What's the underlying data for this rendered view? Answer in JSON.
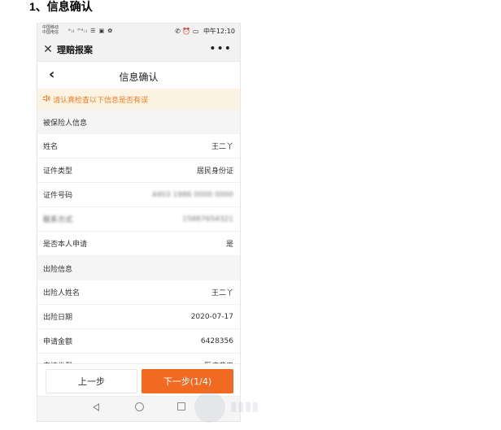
{
  "doc_heading": "1、信息确认",
  "status_bar": {
    "carrier_1": "中国移动",
    "carrier_2": "中国电信",
    "signal_icons": "ᵃᵢₗ ᴴᵃᵢₗ ☰ ▣ ✿",
    "right_icons": "✆ ⏰ ▭",
    "time": "中午12:10"
  },
  "app_bar": {
    "close_glyph": "✕",
    "title": "理赔报案",
    "more_glyph": "•••"
  },
  "page_header": {
    "back_glyph": "‹",
    "title": "信息确认"
  },
  "notice": {
    "text": "请认真检查以下信息是否有误",
    "icon": "speaker-icon"
  },
  "sections": {
    "insured": {
      "title": "被保险人信息",
      "rows": [
        {
          "label": "姓名",
          "value": "王二丫"
        },
        {
          "label": "证件类型",
          "value": "居民身份证"
        },
        {
          "label": "证件号码",
          "value": "4403 1986 0000 0000"
        },
        {
          "label": "联系方式",
          "value": "15887654321"
        },
        {
          "label": "是否本人申请",
          "value": "是"
        }
      ]
    },
    "incident": {
      "title": "出险信息",
      "rows": [
        {
          "label": "出险人姓名",
          "value": "王二丫"
        },
        {
          "label": "出险日期",
          "value": "2020-07-17"
        },
        {
          "label": "申请金额",
          "value": "6428356"
        },
        {
          "label": "申请类型",
          "value": "医疗费用"
        }
      ]
    }
  },
  "buttons": {
    "prev": "上一步",
    "next": "下一步(1/4)"
  },
  "colors": {
    "accent": "#f06a21",
    "notice_bg": "#fdf3e3",
    "notice_text": "#f07c22"
  }
}
